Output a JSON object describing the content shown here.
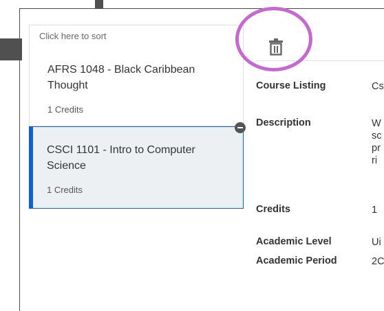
{
  "sort": {
    "placeholder": "Click here to sort"
  },
  "courses": [
    {
      "title": "AFRS 1048 - Black Caribbean Thought",
      "credits": "1 Credits",
      "selected": false
    },
    {
      "title": "CSCI 1101 - Intro to Computer Science",
      "credits": "1 Credits",
      "selected": true
    }
  ],
  "toolbar": {
    "delete_icon": "trash-icon"
  },
  "details": [
    {
      "label": "Course Listing",
      "value": "Cs"
    },
    {
      "label": "Description",
      "value": "W\nsc\npr\nri"
    },
    {
      "label": "Credits",
      "value": "1"
    },
    {
      "label": "Academic Level",
      "value": "Ui"
    },
    {
      "label": "Academic Period",
      "value": "2C"
    }
  ],
  "colors": {
    "accent": "#0f62c8",
    "highlight_ring": "#c569d0",
    "selected_bg": "#edf0f3"
  }
}
